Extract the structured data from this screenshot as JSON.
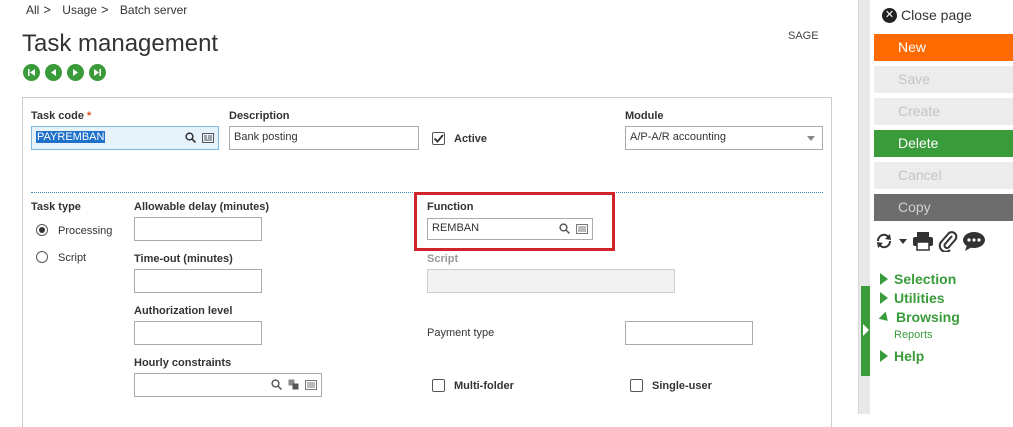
{
  "breadcrumb": {
    "items": [
      "All",
      "Usage",
      "Batch server"
    ],
    "sep": ">"
  },
  "page_title": "Task management",
  "company_code": "SAGE",
  "form": {
    "task_code": {
      "label": "Task code",
      "required_mark": "*",
      "value": "PAYREMBAN"
    },
    "description": {
      "label": "Description",
      "value": "Bank posting"
    },
    "active": {
      "label": "Active",
      "checked": true
    },
    "module": {
      "label": "Module",
      "value": "A/P-A/R accounting"
    },
    "task_type": {
      "label": "Task type",
      "options": [
        "Processing",
        "Script"
      ],
      "selected": "Processing"
    },
    "allowable_delay": {
      "label": "Allowable delay (minutes)",
      "value": ""
    },
    "time_out": {
      "label": "Time-out (minutes)",
      "value": ""
    },
    "authorization_level": {
      "label": "Authorization level",
      "value": ""
    },
    "hourly_constraints": {
      "label": "Hourly constraints",
      "value": ""
    },
    "function": {
      "label": "Function",
      "value": "REMBAN"
    },
    "script": {
      "label": "Script",
      "value": ""
    },
    "payment_type": {
      "label": "Payment type",
      "value": ""
    },
    "multi_folder": {
      "label": "Multi-folder",
      "checked": false
    },
    "single_user": {
      "label": "Single-user",
      "checked": false
    }
  },
  "colors": {
    "accent_green": "#3a9b3a",
    "new_orange": "#ff6a00",
    "highlight_red": "#d0242b"
  },
  "side": {
    "close": "Close page",
    "actions": [
      {
        "label": "New",
        "state": "active"
      },
      {
        "label": "Save",
        "state": "disabled"
      },
      {
        "label": "Create",
        "state": "disabled"
      },
      {
        "label": "Delete",
        "state": "active"
      },
      {
        "label": "Cancel",
        "state": "disabled"
      },
      {
        "label": "Copy",
        "state": "gray"
      }
    ],
    "menus": {
      "selection": "Selection",
      "utilities": "Utilities",
      "browsing": "Browsing",
      "reports": "Reports",
      "help": "Help"
    }
  }
}
